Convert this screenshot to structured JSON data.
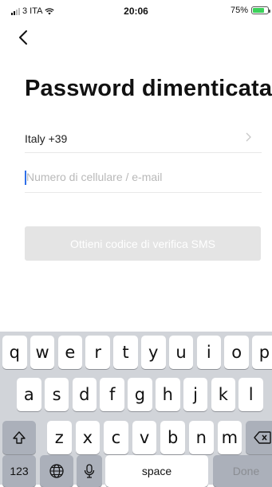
{
  "status_bar": {
    "carrier": "3 ITA",
    "time": "20:06",
    "battery_percent": "75%",
    "battery_level": 0.75,
    "battery_color": "#3bd15a"
  },
  "nav": {
    "back_icon": "chevron-left-icon"
  },
  "page": {
    "title": "Password dimenticata"
  },
  "form": {
    "country_label": "Italy +39",
    "country_chevron_icon": "chevron-right-icon",
    "contact_value": "",
    "contact_placeholder": "Numero di cellulare / e-mail",
    "sms_button_label": "Ottieni codice di verifica SMS",
    "button_color": "#e4e4e4",
    "caret_color": "#2f6fe8"
  },
  "keyboard": {
    "row1": [
      "q",
      "w",
      "e",
      "r",
      "t",
      "y",
      "u",
      "i",
      "o",
      "p"
    ],
    "row2": [
      "a",
      "s",
      "d",
      "f",
      "g",
      "h",
      "j",
      "k",
      "l"
    ],
    "row3": [
      "z",
      "x",
      "c",
      "v",
      "b",
      "n",
      "m"
    ],
    "shift_icon": "shift-icon",
    "backspace_icon": "backspace-icon",
    "numbers_label": "123",
    "globe_icon": "globe-icon",
    "mic_icon": "microphone-icon",
    "space_label": "space",
    "done_label": "Done"
  }
}
